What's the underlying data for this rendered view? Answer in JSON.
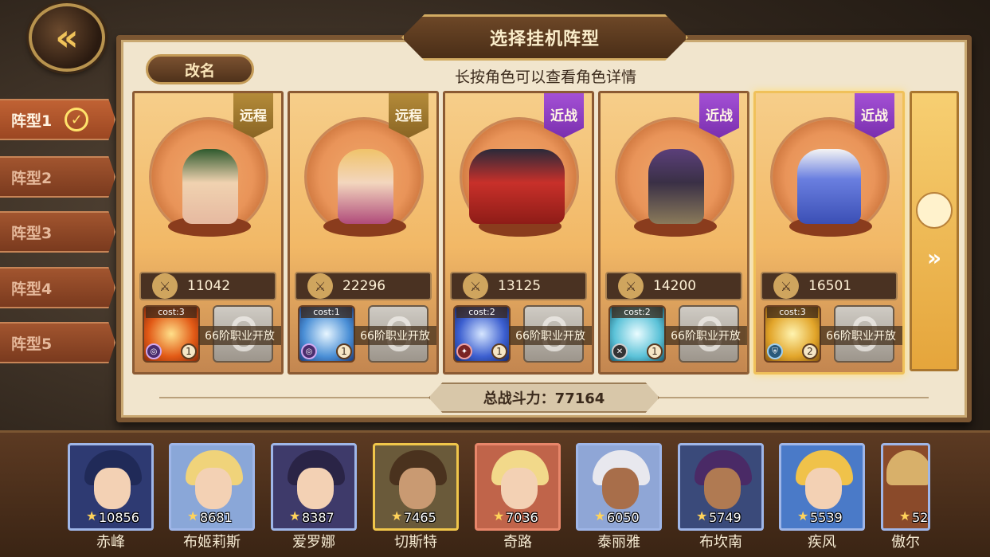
{
  "header": {
    "title": "选择挂机阵型",
    "rename_label": "改名",
    "hint": "长按角色可以查看角色详情",
    "back_icon": "back-arrow-icon"
  },
  "tabs": [
    {
      "label": "阵型1",
      "active": true
    },
    {
      "label": "阵型2",
      "active": false
    },
    {
      "label": "阵型3",
      "active": false
    },
    {
      "label": "阵型4",
      "active": false
    },
    {
      "label": "阵型5",
      "active": false
    }
  ],
  "cards": [
    {
      "role": "远程",
      "power": "11042",
      "cost": "cost:3",
      "skill_level": "1",
      "locked_text": "66阶职业开放",
      "selected": false
    },
    {
      "role": "远程",
      "power": "22296",
      "cost": "cost:1",
      "skill_level": "1",
      "locked_text": "66阶职业开放",
      "selected": false
    },
    {
      "role": "近战",
      "power": "13125",
      "cost": "cost:2",
      "skill_level": "1",
      "locked_text": "66阶职业开放",
      "selected": false
    },
    {
      "role": "近战",
      "power": "14200",
      "cost": "cost:2",
      "skill_level": "1",
      "locked_text": "66阶职业开放",
      "selected": false
    },
    {
      "role": "近战",
      "power": "16501",
      "cost": "cost:3",
      "skill_level": "2",
      "locked_text": "66阶职业开放",
      "selected": true
    }
  ],
  "total_power": "总战斗力：77164",
  "roster": [
    {
      "name": "赤峰",
      "power": "10856"
    },
    {
      "name": "布姬莉斯",
      "power": "8681"
    },
    {
      "name": "爱罗娜",
      "power": "8387"
    },
    {
      "name": "切斯特",
      "power": "7465"
    },
    {
      "name": "奇路",
      "power": "7036"
    },
    {
      "name": "泰丽雅",
      "power": "6050"
    },
    {
      "name": "布坎南",
      "power": "5749"
    },
    {
      "name": "疾风",
      "power": "5539"
    },
    {
      "name": "傲尔",
      "power": "52"
    }
  ],
  "colors": {
    "ranged_badge": "#b48b39",
    "melee_badge": "#a450d5",
    "tab_active": "#c06234",
    "panel_bg": "#f1e5cd"
  }
}
